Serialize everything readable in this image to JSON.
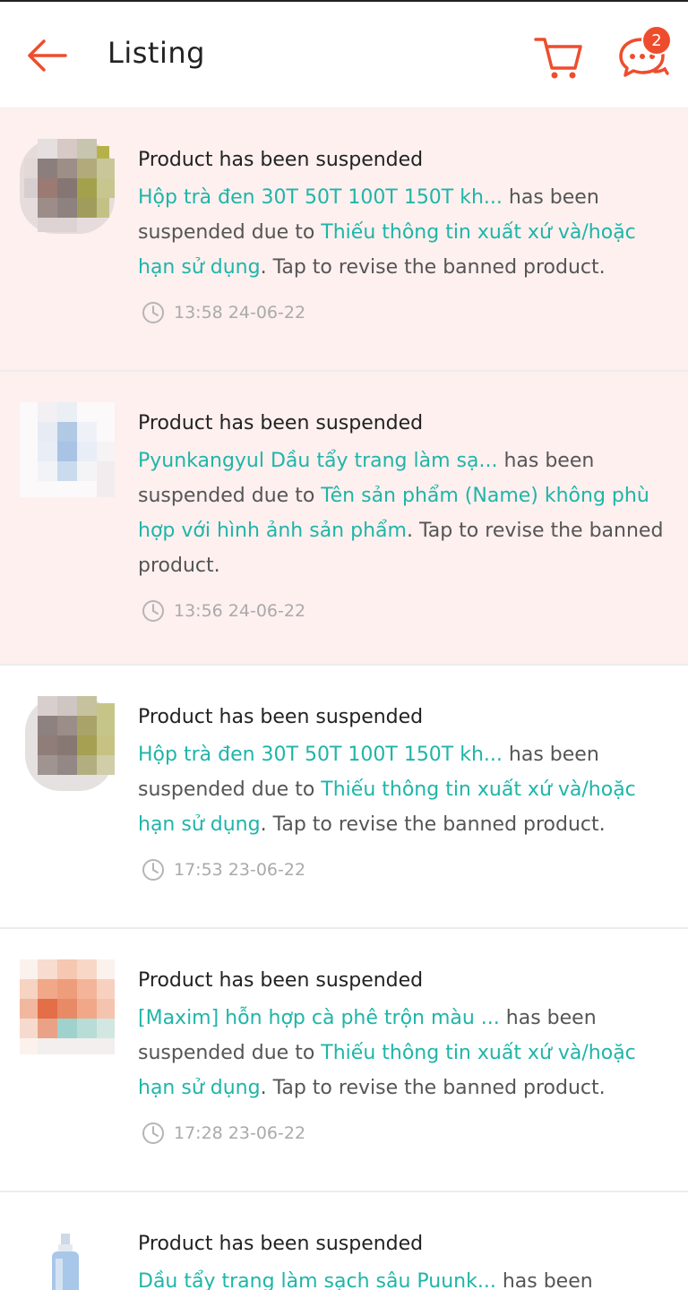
{
  "header": {
    "title": "Listing",
    "chat_badge": "2"
  },
  "colors": {
    "accent": "#ee4d2d",
    "highlight": "#1fb5a8",
    "unread_bg": "#fdf0ef"
  },
  "notifications": [
    {
      "title": "Product has been suspended",
      "product": "Hộp trà đen 30T 50T 100T 150T kh...",
      "mid1": " has been suspended due to ",
      "reason": "Thiếu thông tin xuất xứ và/hoặc hạn sử dụng",
      "tail": ". Tap to revise the banned product.",
      "time": "13:58 24-06-22",
      "thumb_icon": "blurred-product-image"
    },
    {
      "title": "Product has been suspended",
      "product": "Pyunkangyul Dầu tẩy trang làm sạ...",
      "mid1": " has been suspended due to ",
      "reason": "Tên sản phẩm (Name) không phù hợp với hình ảnh sản phẩm",
      "tail": ". Tap to revise the banned product.",
      "time": "13:56 24-06-22",
      "thumb_icon": "blurred-product-image"
    },
    {
      "title": "Product has been suspended",
      "product": "Hộp trà đen 30T 50T 100T 150T kh...",
      "mid1": " has been suspended due to ",
      "reason": "Thiếu thông tin xuất xứ và/hoặc hạn sử dụng",
      "tail": ". Tap to revise the banned product.",
      "time": "17:53 23-06-22",
      "thumb_icon": "blurred-product-image"
    },
    {
      "title": "Product has been suspended",
      "product": "[Maxim] hỗn hợp cà phê trộn màu ...",
      "mid1": " has been suspended due to ",
      "reason": "Thiếu thông tin xuất xứ và/hoặc hạn sử dụng",
      "tail": ". Tap to revise the banned product.",
      "time": "17:28 23-06-22",
      "thumb_icon": "blurred-product-image"
    },
    {
      "title": "Product has been suspended",
      "product": "Dầu tẩy trang làm sạch sâu Puunk...",
      "mid1": " has been",
      "reason": "",
      "tail": "",
      "time": "",
      "thumb_icon": "cleansing-oil-bottle-image"
    }
  ]
}
